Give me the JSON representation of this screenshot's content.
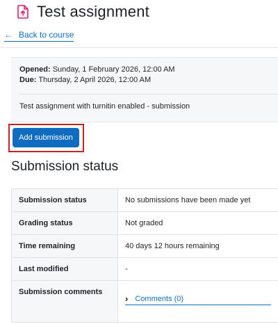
{
  "header": {
    "title": "Test assignment",
    "icon": "assignment-icon",
    "icon_color": "#e01b6a"
  },
  "nav": {
    "back_label": "Back to course",
    "back_icon": "arrow-left-icon"
  },
  "info": {
    "opened_label": "Opened:",
    "opened_value": "Sunday, 1 February 2026, 12:00 AM",
    "due_label": "Due:",
    "due_value": "Thursday, 2 April 2026, 12:00 AM",
    "intro": "Test assignment with turnitin enabled - submission"
  },
  "actions": {
    "add_submission_label": "Add submission",
    "highlight_color": "#cc1f1f",
    "button_color": "#0f6cbf"
  },
  "status_section": {
    "heading": "Submission status",
    "rows": [
      {
        "label": "Submission status",
        "value": "No submissions have been made yet"
      },
      {
        "label": "Grading status",
        "value": "Not graded"
      },
      {
        "label": "Time remaining",
        "value": "40 days 12 hours remaining"
      },
      {
        "label": "Last modified",
        "value": "-"
      },
      {
        "label": "Submission comments",
        "value": ""
      }
    ],
    "comments_link": "Comments (0)",
    "comments_icon": "chevron-right-icon"
  }
}
